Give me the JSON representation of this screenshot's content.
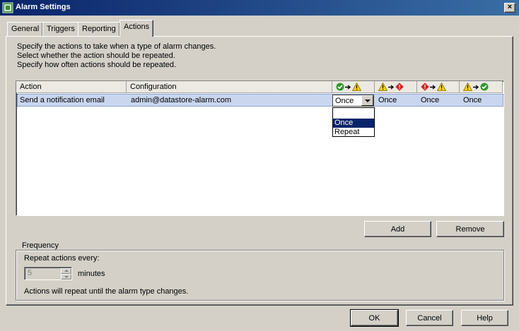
{
  "window": {
    "title": "Alarm Settings",
    "close_glyph": "×"
  },
  "tabs": [
    {
      "label": "General"
    },
    {
      "label": "Triggers"
    },
    {
      "label": "Reporting"
    },
    {
      "label": "Actions",
      "active": true
    }
  ],
  "instructions": [
    "Specify the actions to take when a type of alarm changes.",
    "Select whether the action should be repeated.",
    "Specify how often actions should be repeated."
  ],
  "table": {
    "columns": {
      "action": "Action",
      "configuration": "Configuration",
      "transitions": [
        {
          "from": "ok-icon",
          "to": "warning-icon"
        },
        {
          "from": "warning-icon",
          "to": "alert-icon"
        },
        {
          "from": "alert-icon",
          "to": "warning-icon"
        },
        {
          "from": "warning-icon",
          "to": "ok-icon"
        }
      ]
    },
    "rows": [
      {
        "action": "Send a notification email",
        "configuration": "admin@datastore-alarm.com",
        "t1": "Once",
        "t2": "Once",
        "t3": "Once",
        "t4": "Once"
      }
    ]
  },
  "dropdown": {
    "options": [
      "",
      "Once",
      "Repeat"
    ],
    "selected": "Once"
  },
  "buttons": {
    "add": "Add",
    "remove": "Remove",
    "ok": "OK",
    "cancel": "Cancel",
    "help": "Help"
  },
  "frequency": {
    "legend": "Frequency",
    "repeat_label": "Repeat actions every:",
    "value": "5",
    "unit": "minutes",
    "note": "Actions will repeat until the alarm type changes."
  },
  "colors": {
    "ok": "#2e9a2e",
    "warning": "#f2d21a",
    "alert": "#d42020",
    "selection": "#0a246a",
    "row_highlight": "#c9d6ee"
  }
}
